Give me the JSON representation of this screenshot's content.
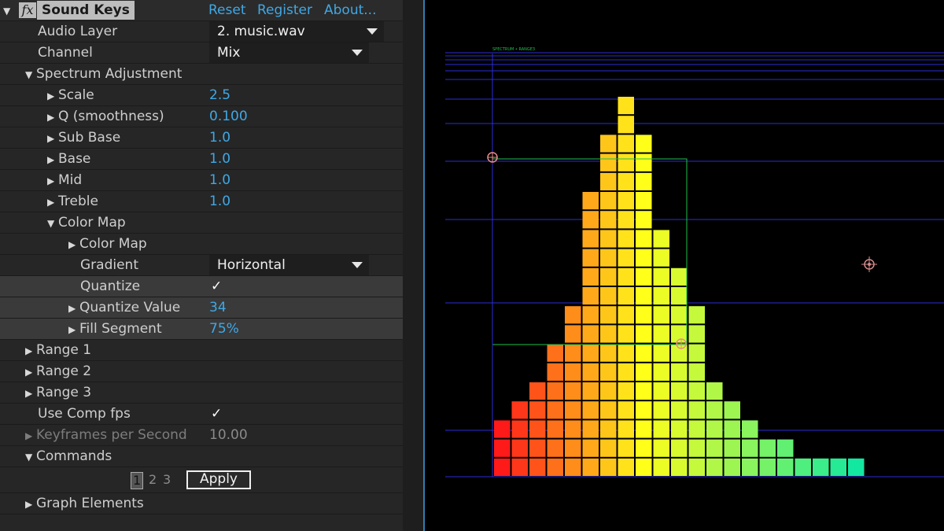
{
  "effect": {
    "fx_label": "fx",
    "name": "Sound Keys",
    "reset": "Reset",
    "register": "Register",
    "about": "About..."
  },
  "rows": {
    "audio_layer": {
      "label": "Audio Layer",
      "value": "2. music.wav"
    },
    "channel": {
      "label": "Channel",
      "value": "Mix"
    },
    "spectrum_adjustment": {
      "label": "Spectrum Adjustment"
    },
    "scale": {
      "label": "Scale",
      "value": "2.5"
    },
    "q": {
      "label": "Q (smoothness)",
      "value": "0.100"
    },
    "sub_base": {
      "label": "Sub Base",
      "value": "1.0"
    },
    "base": {
      "label": "Base",
      "value": "1.0"
    },
    "mid": {
      "label": "Mid",
      "value": "1.0"
    },
    "treble": {
      "label": "Treble",
      "value": "1.0"
    },
    "color_map_group": {
      "label": "Color Map"
    },
    "color_map": {
      "label": "Color Map"
    },
    "gradient": {
      "label": "Gradient",
      "value": "Horizontal"
    },
    "quantize": {
      "label": "Quantize",
      "checked": "✓"
    },
    "quantize_value": {
      "label": "Quantize Value",
      "value": "34"
    },
    "fill_segment": {
      "label": "Fill Segment",
      "value": "75%"
    },
    "range1": {
      "label": "Range 1"
    },
    "range2": {
      "label": "Range 2"
    },
    "range3": {
      "label": "Range 3"
    },
    "use_comp_fps": {
      "label": "Use Comp fps",
      "checked": "✓"
    },
    "keyframes_per_second": {
      "label": "Keyframes per Second",
      "value": "10.00"
    },
    "commands": {
      "label": "Commands",
      "nums": [
        "1",
        "2",
        "3"
      ],
      "apply": "Apply"
    },
    "graph_elements": {
      "label": "Graph Elements"
    }
  },
  "viewer": {
    "spectrum_label": "SPECTRUM • RANGE3",
    "spectrum_heights": [
      3,
      4,
      5,
      7,
      9,
      15,
      18,
      20,
      18,
      13,
      11,
      9,
      5,
      4,
      3,
      2,
      2,
      1,
      1,
      1,
      1
    ],
    "max_segments": 20,
    "colors": {
      "low": "#ff1a1a",
      "mid": "#ffff1a",
      "high": "#13e8a0",
      "guide": "#2b2bd6",
      "box": "#1fbf4a",
      "target": "#e88a8a"
    }
  }
}
